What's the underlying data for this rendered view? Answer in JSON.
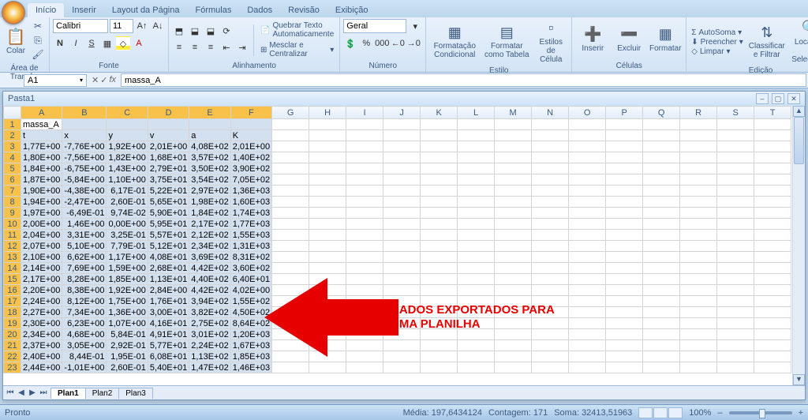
{
  "tabs": [
    "Início",
    "Inserir",
    "Layout da Página",
    "Fórmulas",
    "Dados",
    "Revisão",
    "Exibição"
  ],
  "ribbon": {
    "clipboard": {
      "paste": "Colar",
      "title": "Área de Transf..."
    },
    "font": {
      "name": "Calibri",
      "size": "11",
      "title": "Fonte"
    },
    "align": {
      "wrap": "Quebrar Texto Automaticamente",
      "merge": "Mesclar e Centralizar",
      "title": "Alinhamento"
    },
    "number": {
      "format": "Geral",
      "title": "Número"
    },
    "styles": {
      "cond": "Formatação Condicional",
      "table": "Formatar como Tabela",
      "cell": "Estilos de Célula",
      "title": "Estilo"
    },
    "cells": {
      "ins": "Inserir",
      "del": "Excluir",
      "fmt": "Formatar",
      "title": "Células"
    },
    "editing": {
      "sum": "AutoSoma",
      "fill": "Preencher",
      "clear": "Limpar",
      "sort": "Classificar e Filtrar",
      "find": "Localizar e Selecionar",
      "title": "Edição"
    }
  },
  "namebox": "A1",
  "formula": "massa_A",
  "workbook_title": "Pasta1",
  "columns": [
    "A",
    "B",
    "C",
    "D",
    "E",
    "F",
    "G",
    "H",
    "I",
    "J",
    "K",
    "L",
    "M",
    "N",
    "O",
    "P",
    "Q",
    "R",
    "S",
    "T"
  ],
  "row1": {
    "A": "massa_A"
  },
  "row2": [
    "t",
    "x",
    "y",
    "v",
    "a",
    "K"
  ],
  "chart_data": {
    "type": "table",
    "headers": [
      "t",
      "x",
      "y",
      "v",
      "a",
      "K"
    ],
    "rows": [
      [
        "1,77E+00",
        "-7,76E+00",
        "1,92E+00",
        "2,01E+00",
        "4,08E+02",
        "2,01E+00"
      ],
      [
        "1,80E+00",
        "-7,56E+00",
        "1,82E+00",
        "1,68E+01",
        "3,57E+02",
        "1,40E+02"
      ],
      [
        "1,84E+00",
        "-6,75E+00",
        "1,43E+00",
        "2,79E+01",
        "3,50E+02",
        "3,90E+02"
      ],
      [
        "1,87E+00",
        "-5,84E+00",
        "1,10E+00",
        "3,75E+01",
        "3,54E+02",
        "7,05E+02"
      ],
      [
        "1,90E+00",
        "-4,38E+00",
        "6,17E-01",
        "5,22E+01",
        "2,97E+02",
        "1,36E+03"
      ],
      [
        "1,94E+00",
        "-2,47E+00",
        "2,60E-01",
        "5,65E+01",
        "1,98E+02",
        "1,60E+03"
      ],
      [
        "1,97E+00",
        "-6,49E-01",
        "9,74E-02",
        "5,90E+01",
        "1,84E+02",
        "1,74E+03"
      ],
      [
        "2,00E+00",
        "1,46E+00",
        "0,00E+00",
        "5,95E+01",
        "2,17E+02",
        "1,77E+03"
      ],
      [
        "2,04E+00",
        "3,31E+00",
        "3,25E-01",
        "5,57E+01",
        "2,12E+02",
        "1,55E+03"
      ],
      [
        "2,07E+00",
        "5,10E+00",
        "7,79E-01",
        "5,12E+01",
        "2,34E+02",
        "1,31E+03"
      ],
      [
        "2,10E+00",
        "6,62E+00",
        "1,17E+00",
        "4,08E+01",
        "3,69E+02",
        "8,31E+02"
      ],
      [
        "2,14E+00",
        "7,69E+00",
        "1,59E+00",
        "2,68E+01",
        "4,42E+02",
        "3,60E+02"
      ],
      [
        "2,17E+00",
        "8,28E+00",
        "1,85E+00",
        "1,13E+01",
        "4,40E+02",
        "6,40E+01"
      ],
      [
        "2,20E+00",
        "8,38E+00",
        "1,92E+00",
        "2,84E+00",
        "4,42E+02",
        "4,02E+00"
      ],
      [
        "2,24E+00",
        "8,12E+00",
        "1,75E+00",
        "1,76E+01",
        "3,94E+02",
        "1,55E+02"
      ],
      [
        "2,27E+00",
        "7,34E+00",
        "1,36E+00",
        "3,00E+01",
        "3,82E+02",
        "4,50E+02"
      ],
      [
        "2,30E+00",
        "6,23E+00",
        "1,07E+00",
        "4,16E+01",
        "2,75E+02",
        "8,64E+02"
      ],
      [
        "2,34E+00",
        "4,68E+00",
        "5,84E-01",
        "4,91E+01",
        "3,01E+02",
        "1,20E+03"
      ],
      [
        "2,37E+00",
        "3,05E+00",
        "2,92E-01",
        "5,77E+01",
        "2,24E+02",
        "1,67E+03"
      ],
      [
        "2,40E+00",
        "8,44E-01",
        "1,95E-01",
        "6,08E+01",
        "1,13E+02",
        "1,85E+03"
      ],
      [
        "2,44E+00",
        "-1,01E+00",
        "2,60E-01",
        "5,40E+01",
        "1,47E+02",
        "1,46E+03"
      ]
    ]
  },
  "sheet_tabs": [
    "Plan1",
    "Plan2",
    "Plan3"
  ],
  "annotation": {
    "line1": "DADOS EXPORTADOS PARA",
    "line2": "UMA PLANILHA"
  },
  "status": {
    "ready": "Pronto",
    "avg_label": "Média:",
    "avg": "197,6434124",
    "count_label": "Contagem:",
    "count": "171",
    "sum_label": "Soma:",
    "sum": "32413,51963",
    "zoom": "100%"
  }
}
